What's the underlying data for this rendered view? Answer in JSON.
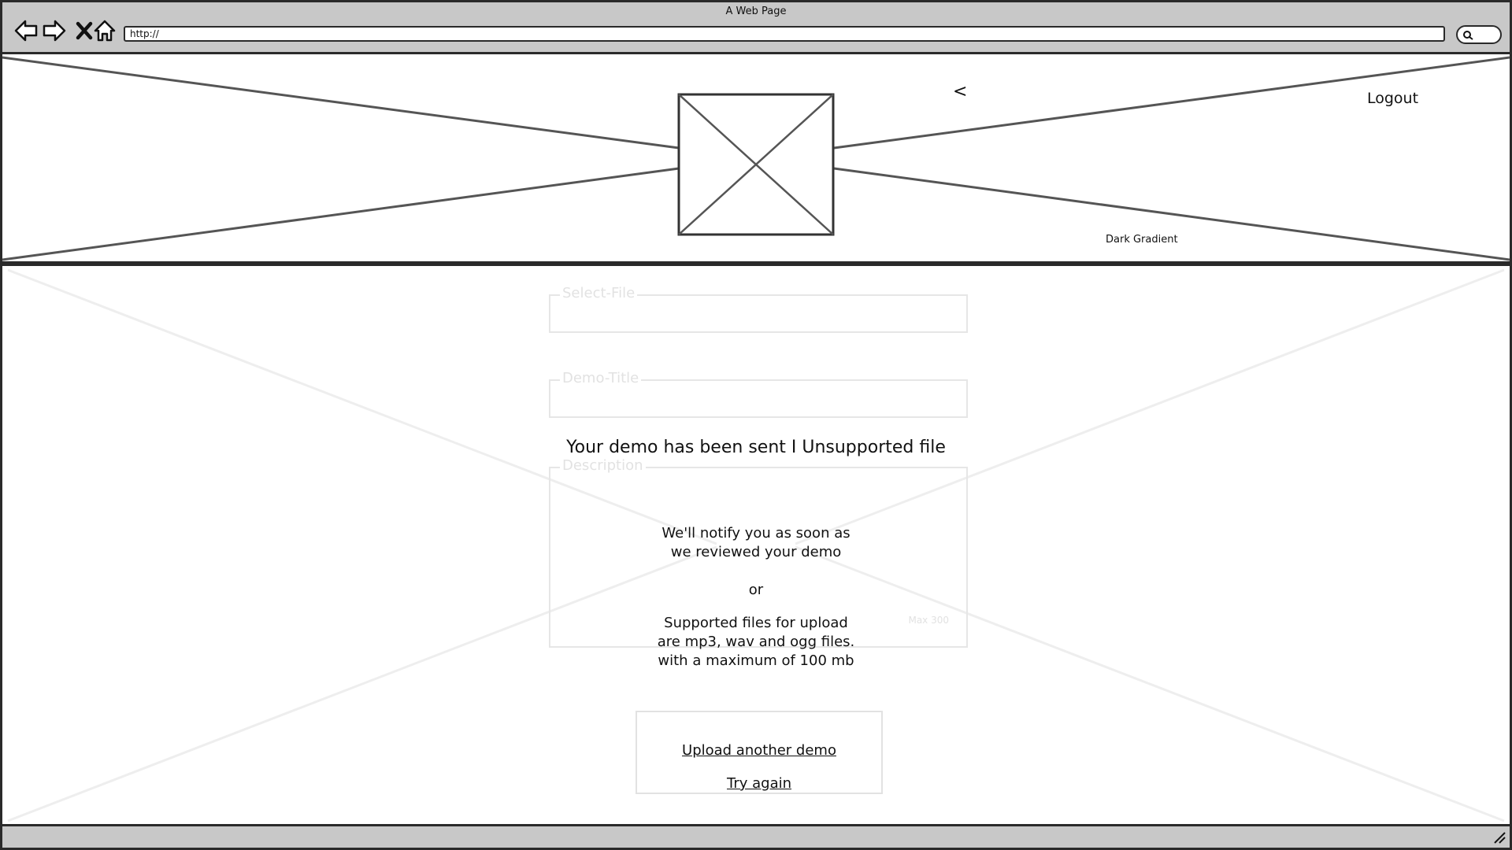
{
  "browser": {
    "window_title": "A Web Page",
    "url": "http://"
  },
  "header": {
    "logout_label": "Logout",
    "back_glyph": "<",
    "background_label": "Dark Gradient",
    "logo_icon": "image-placeholder-icon"
  },
  "form": {
    "select_file_label": "Select-File",
    "demo_title_label": "Demo-Title",
    "description_label": "Description",
    "description_counter": "Max 300"
  },
  "message": {
    "title": "Your demo has been sent I Unsupported file",
    "success_line1": "We'll notify you as soon as",
    "success_line2": "we reviewed your demo",
    "separator": "or",
    "error_line1": "Supported files for upload",
    "error_line2": "are mp3, wav and ogg files.",
    "error_line3": "with a maximum of 100 mb"
  },
  "actions": {
    "upload_another_label": "Upload another demo",
    "try_again_label": "Try again"
  },
  "colors": {
    "chrome_bg": "#c8c8c8",
    "border": "#2a2a2a",
    "ghost": "#e6e6e6"
  }
}
